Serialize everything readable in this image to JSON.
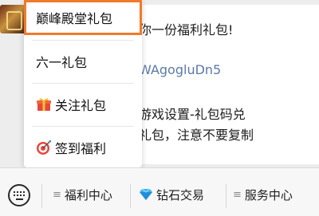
{
  "chat": {
    "message_lines": [
      "你一份福利礼包!",
      "WAgogluDn5",
      "游戏设置-礼包码兑",
      "礼包，注意不要复制"
    ]
  },
  "popup_menu": {
    "items": [
      {
        "label": "巅峰殿堂礼包",
        "icon": "",
        "highlighted": true
      },
      {
        "label": "六一礼包",
        "icon": ""
      },
      {
        "label": "关注礼包",
        "icon": "gift-icon"
      },
      {
        "label": "签到福利",
        "icon": "target-icon"
      }
    ]
  },
  "bottom_menu": {
    "items": [
      {
        "label": "福利中心",
        "icon": "menu-lines-icon"
      },
      {
        "label": "钻石交易",
        "icon": "diamond-icon"
      },
      {
        "label": "服务中心",
        "icon": "menu-lines-icon"
      }
    ]
  },
  "colors": {
    "highlight": "#f07a2c",
    "link": "#5c79a8",
    "background": "#ededed"
  }
}
